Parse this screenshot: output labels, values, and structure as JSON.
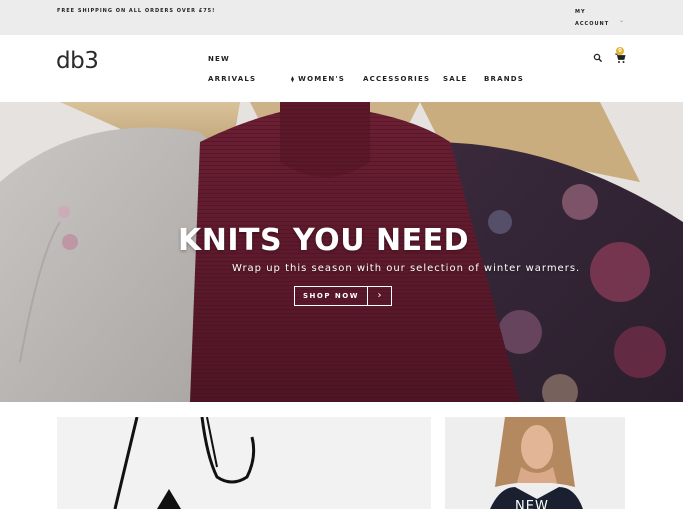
{
  "topbar": {
    "promo": "FREE SHIPPING ON ALL ORDERS OVER £75!",
    "account_line1": "MY",
    "account_line2": "ACCOUNT"
  },
  "header": {
    "logo": "db3",
    "nav": {
      "new_line1": "NEW",
      "new_line2": "ARRIVALS",
      "womens": "WOMEN'S",
      "accessories": "ACCESSORIES",
      "sale": "SALE",
      "brands": "BRANDS"
    },
    "cart_count": "0"
  },
  "hero": {
    "title": "KNITS YOU NEED",
    "subtitle": "Wrap up this season with our selection of winter warmers.",
    "cta": "SHOP NOW",
    "cta_arrow": "›"
  },
  "tiles": {
    "right_label": "NEW"
  },
  "colors": {
    "topbar_bg": "#ececec",
    "accent_badge": "#e1b531",
    "sweater_burgundy": "#5e1a2b"
  }
}
